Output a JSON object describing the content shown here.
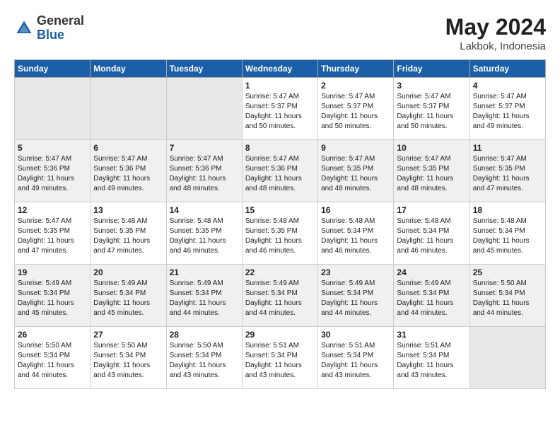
{
  "header": {
    "logo": {
      "general": "General",
      "blue": "Blue"
    },
    "title": "May 2024",
    "location": "Lakbok, Indonesia"
  },
  "weekdays": [
    "Sunday",
    "Monday",
    "Tuesday",
    "Wednesday",
    "Thursday",
    "Friday",
    "Saturday"
  ],
  "weeks": [
    [
      {
        "day": "",
        "info": ""
      },
      {
        "day": "",
        "info": ""
      },
      {
        "day": "",
        "info": ""
      },
      {
        "day": "1",
        "info": "Sunrise: 5:47 AM\nSunset: 5:37 PM\nDaylight: 11 hours\nand 50 minutes."
      },
      {
        "day": "2",
        "info": "Sunrise: 5:47 AM\nSunset: 5:37 PM\nDaylight: 11 hours\nand 50 minutes."
      },
      {
        "day": "3",
        "info": "Sunrise: 5:47 AM\nSunset: 5:37 PM\nDaylight: 11 hours\nand 50 minutes."
      },
      {
        "day": "4",
        "info": "Sunrise: 5:47 AM\nSunset: 5:37 PM\nDaylight: 11 hours\nand 49 minutes."
      }
    ],
    [
      {
        "day": "5",
        "info": "Sunrise: 5:47 AM\nSunset: 5:36 PM\nDaylight: 11 hours\nand 49 minutes."
      },
      {
        "day": "6",
        "info": "Sunrise: 5:47 AM\nSunset: 5:36 PM\nDaylight: 11 hours\nand 49 minutes."
      },
      {
        "day": "7",
        "info": "Sunrise: 5:47 AM\nSunset: 5:36 PM\nDaylight: 11 hours\nand 48 minutes."
      },
      {
        "day": "8",
        "info": "Sunrise: 5:47 AM\nSunset: 5:36 PM\nDaylight: 11 hours\nand 48 minutes."
      },
      {
        "day": "9",
        "info": "Sunrise: 5:47 AM\nSunset: 5:35 PM\nDaylight: 11 hours\nand 48 minutes."
      },
      {
        "day": "10",
        "info": "Sunrise: 5:47 AM\nSunset: 5:35 PM\nDaylight: 11 hours\nand 48 minutes."
      },
      {
        "day": "11",
        "info": "Sunrise: 5:47 AM\nSunset: 5:35 PM\nDaylight: 11 hours\nand 47 minutes."
      }
    ],
    [
      {
        "day": "12",
        "info": "Sunrise: 5:47 AM\nSunset: 5:35 PM\nDaylight: 11 hours\nand 47 minutes."
      },
      {
        "day": "13",
        "info": "Sunrise: 5:48 AM\nSunset: 5:35 PM\nDaylight: 11 hours\nand 47 minutes."
      },
      {
        "day": "14",
        "info": "Sunrise: 5:48 AM\nSunset: 5:35 PM\nDaylight: 11 hours\nand 46 minutes."
      },
      {
        "day": "15",
        "info": "Sunrise: 5:48 AM\nSunset: 5:35 PM\nDaylight: 11 hours\nand 46 minutes."
      },
      {
        "day": "16",
        "info": "Sunrise: 5:48 AM\nSunset: 5:34 PM\nDaylight: 11 hours\nand 46 minutes."
      },
      {
        "day": "17",
        "info": "Sunrise: 5:48 AM\nSunset: 5:34 PM\nDaylight: 11 hours\nand 46 minutes."
      },
      {
        "day": "18",
        "info": "Sunrise: 5:48 AM\nSunset: 5:34 PM\nDaylight: 11 hours\nand 45 minutes."
      }
    ],
    [
      {
        "day": "19",
        "info": "Sunrise: 5:49 AM\nSunset: 5:34 PM\nDaylight: 11 hours\nand 45 minutes."
      },
      {
        "day": "20",
        "info": "Sunrise: 5:49 AM\nSunset: 5:34 PM\nDaylight: 11 hours\nand 45 minutes."
      },
      {
        "day": "21",
        "info": "Sunrise: 5:49 AM\nSunset: 5:34 PM\nDaylight: 11 hours\nand 44 minutes."
      },
      {
        "day": "22",
        "info": "Sunrise: 5:49 AM\nSunset: 5:34 PM\nDaylight: 11 hours\nand 44 minutes."
      },
      {
        "day": "23",
        "info": "Sunrise: 5:49 AM\nSunset: 5:34 PM\nDaylight: 11 hours\nand 44 minutes."
      },
      {
        "day": "24",
        "info": "Sunrise: 5:49 AM\nSunset: 5:34 PM\nDaylight: 11 hours\nand 44 minutes."
      },
      {
        "day": "25",
        "info": "Sunrise: 5:50 AM\nSunset: 5:34 PM\nDaylight: 11 hours\nand 44 minutes."
      }
    ],
    [
      {
        "day": "26",
        "info": "Sunrise: 5:50 AM\nSunset: 5:34 PM\nDaylight: 11 hours\nand 44 minutes."
      },
      {
        "day": "27",
        "info": "Sunrise: 5:50 AM\nSunset: 5:34 PM\nDaylight: 11 hours\nand 43 minutes."
      },
      {
        "day": "28",
        "info": "Sunrise: 5:50 AM\nSunset: 5:34 PM\nDaylight: 11 hours\nand 43 minutes."
      },
      {
        "day": "29",
        "info": "Sunrise: 5:51 AM\nSunset: 5:34 PM\nDaylight: 11 hours\nand 43 minutes."
      },
      {
        "day": "30",
        "info": "Sunrise: 5:51 AM\nSunset: 5:34 PM\nDaylight: 11 hours\nand 43 minutes."
      },
      {
        "day": "31",
        "info": "Sunrise: 5:51 AM\nSunset: 5:34 PM\nDaylight: 11 hours\nand 43 minutes."
      },
      {
        "day": "",
        "info": ""
      }
    ]
  ]
}
